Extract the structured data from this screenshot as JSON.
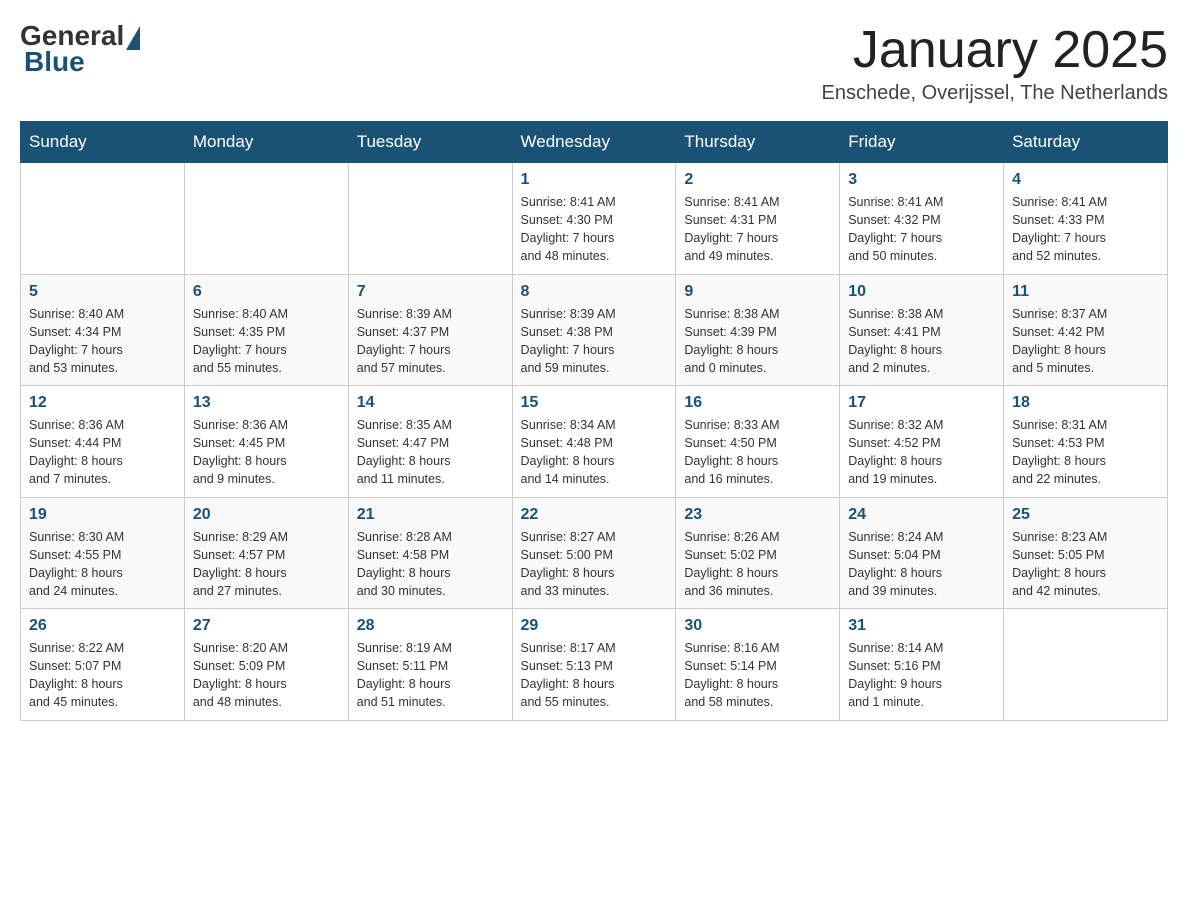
{
  "header": {
    "logo": {
      "general": "General",
      "blue": "Blue"
    },
    "title": "January 2025",
    "location": "Enschede, Overijssel, The Netherlands"
  },
  "calendar": {
    "days_of_week": [
      "Sunday",
      "Monday",
      "Tuesday",
      "Wednesday",
      "Thursday",
      "Friday",
      "Saturday"
    ],
    "weeks": [
      [
        {
          "day": "",
          "info": ""
        },
        {
          "day": "",
          "info": ""
        },
        {
          "day": "",
          "info": ""
        },
        {
          "day": "1",
          "info": "Sunrise: 8:41 AM\nSunset: 4:30 PM\nDaylight: 7 hours\nand 48 minutes."
        },
        {
          "day": "2",
          "info": "Sunrise: 8:41 AM\nSunset: 4:31 PM\nDaylight: 7 hours\nand 49 minutes."
        },
        {
          "day": "3",
          "info": "Sunrise: 8:41 AM\nSunset: 4:32 PM\nDaylight: 7 hours\nand 50 minutes."
        },
        {
          "day": "4",
          "info": "Sunrise: 8:41 AM\nSunset: 4:33 PM\nDaylight: 7 hours\nand 52 minutes."
        }
      ],
      [
        {
          "day": "5",
          "info": "Sunrise: 8:40 AM\nSunset: 4:34 PM\nDaylight: 7 hours\nand 53 minutes."
        },
        {
          "day": "6",
          "info": "Sunrise: 8:40 AM\nSunset: 4:35 PM\nDaylight: 7 hours\nand 55 minutes."
        },
        {
          "day": "7",
          "info": "Sunrise: 8:39 AM\nSunset: 4:37 PM\nDaylight: 7 hours\nand 57 minutes."
        },
        {
          "day": "8",
          "info": "Sunrise: 8:39 AM\nSunset: 4:38 PM\nDaylight: 7 hours\nand 59 minutes."
        },
        {
          "day": "9",
          "info": "Sunrise: 8:38 AM\nSunset: 4:39 PM\nDaylight: 8 hours\nand 0 minutes."
        },
        {
          "day": "10",
          "info": "Sunrise: 8:38 AM\nSunset: 4:41 PM\nDaylight: 8 hours\nand 2 minutes."
        },
        {
          "day": "11",
          "info": "Sunrise: 8:37 AM\nSunset: 4:42 PM\nDaylight: 8 hours\nand 5 minutes."
        }
      ],
      [
        {
          "day": "12",
          "info": "Sunrise: 8:36 AM\nSunset: 4:44 PM\nDaylight: 8 hours\nand 7 minutes."
        },
        {
          "day": "13",
          "info": "Sunrise: 8:36 AM\nSunset: 4:45 PM\nDaylight: 8 hours\nand 9 minutes."
        },
        {
          "day": "14",
          "info": "Sunrise: 8:35 AM\nSunset: 4:47 PM\nDaylight: 8 hours\nand 11 minutes."
        },
        {
          "day": "15",
          "info": "Sunrise: 8:34 AM\nSunset: 4:48 PM\nDaylight: 8 hours\nand 14 minutes."
        },
        {
          "day": "16",
          "info": "Sunrise: 8:33 AM\nSunset: 4:50 PM\nDaylight: 8 hours\nand 16 minutes."
        },
        {
          "day": "17",
          "info": "Sunrise: 8:32 AM\nSunset: 4:52 PM\nDaylight: 8 hours\nand 19 minutes."
        },
        {
          "day": "18",
          "info": "Sunrise: 8:31 AM\nSunset: 4:53 PM\nDaylight: 8 hours\nand 22 minutes."
        }
      ],
      [
        {
          "day": "19",
          "info": "Sunrise: 8:30 AM\nSunset: 4:55 PM\nDaylight: 8 hours\nand 24 minutes."
        },
        {
          "day": "20",
          "info": "Sunrise: 8:29 AM\nSunset: 4:57 PM\nDaylight: 8 hours\nand 27 minutes."
        },
        {
          "day": "21",
          "info": "Sunrise: 8:28 AM\nSunset: 4:58 PM\nDaylight: 8 hours\nand 30 minutes."
        },
        {
          "day": "22",
          "info": "Sunrise: 8:27 AM\nSunset: 5:00 PM\nDaylight: 8 hours\nand 33 minutes."
        },
        {
          "day": "23",
          "info": "Sunrise: 8:26 AM\nSunset: 5:02 PM\nDaylight: 8 hours\nand 36 minutes."
        },
        {
          "day": "24",
          "info": "Sunrise: 8:24 AM\nSunset: 5:04 PM\nDaylight: 8 hours\nand 39 minutes."
        },
        {
          "day": "25",
          "info": "Sunrise: 8:23 AM\nSunset: 5:05 PM\nDaylight: 8 hours\nand 42 minutes."
        }
      ],
      [
        {
          "day": "26",
          "info": "Sunrise: 8:22 AM\nSunset: 5:07 PM\nDaylight: 8 hours\nand 45 minutes."
        },
        {
          "day": "27",
          "info": "Sunrise: 8:20 AM\nSunset: 5:09 PM\nDaylight: 8 hours\nand 48 minutes."
        },
        {
          "day": "28",
          "info": "Sunrise: 8:19 AM\nSunset: 5:11 PM\nDaylight: 8 hours\nand 51 minutes."
        },
        {
          "day": "29",
          "info": "Sunrise: 8:17 AM\nSunset: 5:13 PM\nDaylight: 8 hours\nand 55 minutes."
        },
        {
          "day": "30",
          "info": "Sunrise: 8:16 AM\nSunset: 5:14 PM\nDaylight: 8 hours\nand 58 minutes."
        },
        {
          "day": "31",
          "info": "Sunrise: 8:14 AM\nSunset: 5:16 PM\nDaylight: 9 hours\nand 1 minute."
        },
        {
          "day": "",
          "info": ""
        }
      ]
    ]
  }
}
